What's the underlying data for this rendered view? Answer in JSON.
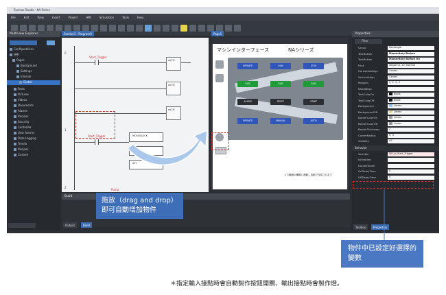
{
  "window": {
    "title": "Sysmac Studio - NA Series"
  },
  "menu": [
    "File",
    "Edit",
    "View",
    "Insert",
    "Project",
    "HMI",
    "Simulation",
    "Tools",
    "Help"
  ],
  "explorer": {
    "title": "Multiview Explorer",
    "items": [
      "Configurations",
      "HMI",
      "Pages",
      "Background",
      "Settings",
      "Internal",
      "Global",
      "Parts",
      "Pictures",
      "Videos",
      "Documents",
      "Alarms",
      "Recipes",
      "Security",
      "Controller",
      "User Alarms",
      "Data Logging",
      "Trends",
      "Recipes",
      "Custom"
    ]
  },
  "ladder": {
    "tab": "Section1 - Program0",
    "rungs": [
      "0",
      "1",
      "2"
    ],
    "contact_label": "Start_Trigger",
    "contact_label_2": "Start_Trigger",
    "bottom_label": "Pump"
  },
  "hmi": {
    "tab": "Page1",
    "title_left": "マシンインターフェース",
    "title_right": "NAシリーズ",
    "note": "入力機器の種類に連動し自動で作成されます"
  },
  "properties": {
    "title": "Properties",
    "filter": "Filter",
    "rows": [
      {
        "k": "Group",
        "v": "Rectangle"
      },
      {
        "k": "TextButton",
        "v": "Momentary Button",
        "bold": true
      },
      {
        "k": "TextButton",
        "v": "Momentary Button On",
        "bold": true
      },
      {
        "k": "Font",
        "v": "Segoe UI, 12, Normal"
      },
      {
        "k": "HorizontalAlign",
        "v": "Center"
      },
      {
        "k": "VerticalAlign",
        "v": "Center"
      },
      {
        "k": "Margins",
        "v": "2, 2, 2, 2"
      },
      {
        "k": "WordWrap",
        "v": ""
      },
      {
        "k": "TextColorOn",
        "v": "Black",
        "swatch": "#111111"
      },
      {
        "k": "TextColorOff",
        "v": "Black",
        "swatch": "#111111"
      },
      {
        "k": "Background",
        "v": "Linear",
        "swatch": "#8fc6ee"
      },
      {
        "k": "BackgroundOff",
        "v": "Linear",
        "swatch": "#e8d9a0"
      },
      {
        "k": "BorderColorOn",
        "v": "Linear",
        "swatch": "#999999"
      },
      {
        "k": "BorderColorOff",
        "v": "Linear",
        "swatch": "#999999"
      },
      {
        "k": "BorderThickness",
        "v": "2"
      },
      {
        "k": "CornerRadius",
        "v": "0, 0"
      },
      {
        "k": "Visibility",
        "v": "All"
      }
    ],
    "behavior_header": "Behavior",
    "behavior_rows": [
      {
        "k": "Variable",
        "v": "Nj1_b_Start_Trigger",
        "red": true
      },
      {
        "k": "IsEnabled",
        "v": ""
      },
      {
        "k": "DoubleTouch",
        "v": ""
      },
      {
        "k": "OnDelayTime",
        "v": "0"
      },
      {
        "k": "OffDelayTime",
        "v": "0"
      }
    ],
    "tabs": [
      "Toolbox",
      "Properties"
    ]
  },
  "build": {
    "title": "Build",
    "tabs": [
      "Output",
      "Build"
    ]
  },
  "annotations": {
    "drag_drop_line1": "拖放（drag and drop）",
    "drag_drop_line2": "即可自動增加物件",
    "variable_line1": "物件中已設定好選擇的",
    "variable_line2": "變數",
    "footnote": "＊指定輸入接點時會自動製作按鈕開關、輸出接點時會製作燈。"
  },
  "colors": {
    "accent": "#3e6eb8",
    "highlight_dash": "#d0312d"
  }
}
